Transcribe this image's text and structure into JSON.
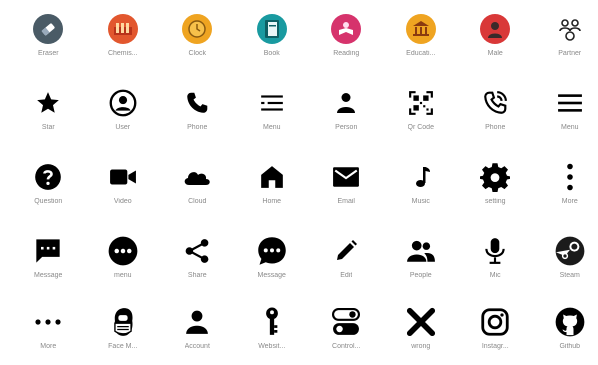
{
  "rows": [
    [
      {
        "label": "Eraser",
        "icon": "eraser-icon",
        "bg": "#4a5b66"
      },
      {
        "label": "Chemis...",
        "icon": "chemistry-icon",
        "bg": "#e2572e"
      },
      {
        "label": "Clock",
        "icon": "clock-icon",
        "bg": "#efa421"
      },
      {
        "label": "Book",
        "icon": "book-icon",
        "bg": "#199aa0"
      },
      {
        "label": "Reading",
        "icon": "reading-icon",
        "bg": "#d6336c"
      },
      {
        "label": "Educati...",
        "icon": "education-icon",
        "bg": "#efa421"
      },
      {
        "label": "Male",
        "icon": "male-icon",
        "bg": "#d93838"
      },
      {
        "label": "Partner",
        "icon": "partner-icon",
        "bg": ""
      }
    ],
    [
      {
        "label": "Star",
        "icon": "star-icon"
      },
      {
        "label": "User",
        "icon": "user-icon"
      },
      {
        "label": "Phone",
        "icon": "phone-icon"
      },
      {
        "label": "Menu",
        "icon": "menu-icon"
      },
      {
        "label": "Person",
        "icon": "person-icon"
      },
      {
        "label": "Qr Code",
        "icon": "qr-code-icon"
      },
      {
        "label": "Phone",
        "icon": "phone-call-icon"
      },
      {
        "label": "Menu",
        "icon": "hamburger-icon"
      }
    ],
    [
      {
        "label": "Question",
        "icon": "question-icon"
      },
      {
        "label": "Video",
        "icon": "video-icon"
      },
      {
        "label": "Cloud",
        "icon": "cloud-icon"
      },
      {
        "label": "Home",
        "icon": "home-icon"
      },
      {
        "label": "Email",
        "icon": "email-icon"
      },
      {
        "label": "Music",
        "icon": "music-icon"
      },
      {
        "label": "setting",
        "icon": "gear-icon"
      },
      {
        "label": "More",
        "icon": "more-vertical-icon"
      }
    ],
    [
      {
        "label": "Message",
        "icon": "message-icon"
      },
      {
        "label": "menu",
        "icon": "menu-dots-icon"
      },
      {
        "label": "Share",
        "icon": "share-icon"
      },
      {
        "label": "Message",
        "icon": "chat-icon"
      },
      {
        "label": "Edit",
        "icon": "edit-icon"
      },
      {
        "label": "People",
        "icon": "people-icon"
      },
      {
        "label": "Mic",
        "icon": "mic-icon"
      },
      {
        "label": "Steam",
        "icon": "steam-icon"
      }
    ],
    [
      {
        "label": "More",
        "icon": "more-horizontal-icon"
      },
      {
        "label": "Face M...",
        "icon": "face-mask-icon"
      },
      {
        "label": "Account",
        "icon": "account-icon"
      },
      {
        "label": "Websit...",
        "icon": "key-icon"
      },
      {
        "label": "Control...",
        "icon": "toggle-icon"
      },
      {
        "label": "wrong",
        "icon": "wrong-icon"
      },
      {
        "label": "Instagr...",
        "icon": "instagram-icon"
      },
      {
        "label": "Github",
        "icon": "github-icon"
      }
    ]
  ]
}
